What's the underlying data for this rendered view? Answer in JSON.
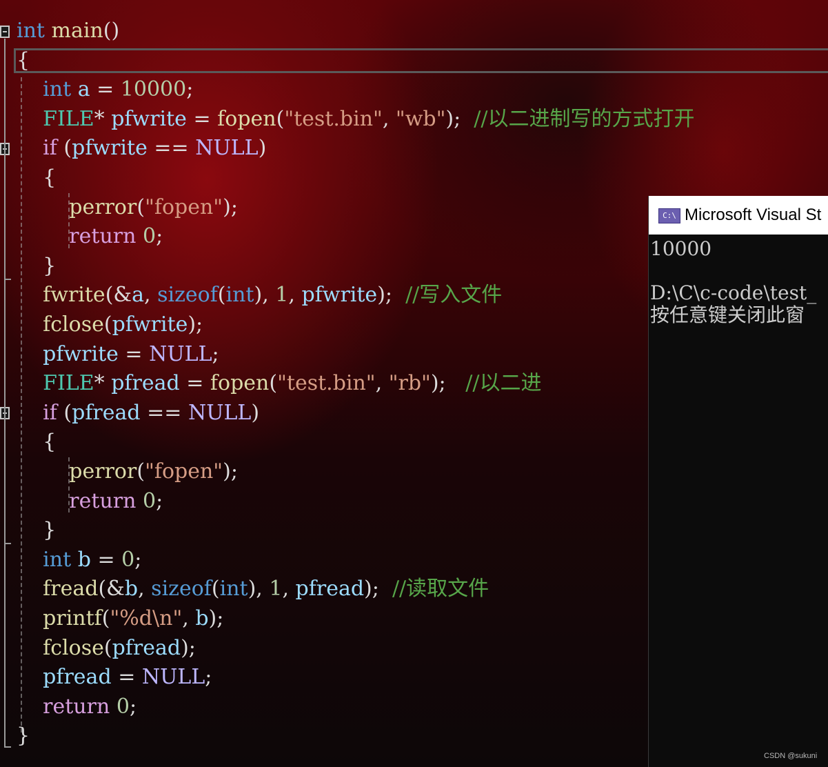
{
  "editor": {
    "lines": [
      [
        {
          "t": "int",
          "c": "kw"
        },
        {
          "t": " ",
          "c": "pl"
        },
        {
          "t": "main",
          "c": "fn"
        },
        {
          "t": "()",
          "c": "pl"
        }
      ],
      [
        {
          "t": "{",
          "c": "pl"
        }
      ],
      [
        {
          "t": "    ",
          "c": "pl"
        },
        {
          "t": "int",
          "c": "kw"
        },
        {
          "t": " ",
          "c": "pl"
        },
        {
          "t": "a",
          "c": "var"
        },
        {
          "t": " = ",
          "c": "pl"
        },
        {
          "t": "10000",
          "c": "num"
        },
        {
          "t": ";",
          "c": "pl"
        }
      ],
      [
        {
          "t": "    ",
          "c": "pl"
        },
        {
          "t": "FILE",
          "c": "ty"
        },
        {
          "t": "* ",
          "c": "pl"
        },
        {
          "t": "pfwrite",
          "c": "var"
        },
        {
          "t": " = ",
          "c": "pl"
        },
        {
          "t": "fopen",
          "c": "fn"
        },
        {
          "t": "(",
          "c": "pl"
        },
        {
          "t": "\"test.bin\"",
          "c": "str"
        },
        {
          "t": ", ",
          "c": "pl"
        },
        {
          "t": "\"wb\"",
          "c": "str"
        },
        {
          "t": ");  ",
          "c": "pl"
        },
        {
          "t": "//以二进制写的方式打开",
          "c": "cmt"
        }
      ],
      [
        {
          "t": "    ",
          "c": "pl"
        },
        {
          "t": "if",
          "c": "ctl"
        },
        {
          "t": " (",
          "c": "pl"
        },
        {
          "t": "pfwrite",
          "c": "var"
        },
        {
          "t": " == ",
          "c": "pl"
        },
        {
          "t": "NULL",
          "c": "mac"
        },
        {
          "t": ")",
          "c": "pl"
        }
      ],
      [
        {
          "t": "    {",
          "c": "pl"
        }
      ],
      [
        {
          "t": "        ",
          "c": "pl"
        },
        {
          "t": "perror",
          "c": "fn"
        },
        {
          "t": "(",
          "c": "pl"
        },
        {
          "t": "\"fopen\"",
          "c": "str"
        },
        {
          "t": ");",
          "c": "pl"
        }
      ],
      [
        {
          "t": "        ",
          "c": "pl"
        },
        {
          "t": "return",
          "c": "ctl"
        },
        {
          "t": " ",
          "c": "pl"
        },
        {
          "t": "0",
          "c": "num"
        },
        {
          "t": ";",
          "c": "pl"
        }
      ],
      [
        {
          "t": "    }",
          "c": "pl"
        }
      ],
      [
        {
          "t": "    ",
          "c": "pl"
        },
        {
          "t": "fwrite",
          "c": "fn"
        },
        {
          "t": "(&",
          "c": "pl"
        },
        {
          "t": "a",
          "c": "var"
        },
        {
          "t": ", ",
          "c": "pl"
        },
        {
          "t": "sizeof",
          "c": "kw"
        },
        {
          "t": "(",
          "c": "pl"
        },
        {
          "t": "int",
          "c": "kw"
        },
        {
          "t": "), ",
          "c": "pl"
        },
        {
          "t": "1",
          "c": "num"
        },
        {
          "t": ", ",
          "c": "pl"
        },
        {
          "t": "pfwrite",
          "c": "var"
        },
        {
          "t": ");  ",
          "c": "pl"
        },
        {
          "t": "//写入文件",
          "c": "cmt"
        }
      ],
      [
        {
          "t": "    ",
          "c": "pl"
        },
        {
          "t": "fclose",
          "c": "fn"
        },
        {
          "t": "(",
          "c": "pl"
        },
        {
          "t": "pfwrite",
          "c": "var"
        },
        {
          "t": ");",
          "c": "pl"
        }
      ],
      [
        {
          "t": "    ",
          "c": "pl"
        },
        {
          "t": "pfwrite",
          "c": "var"
        },
        {
          "t": " = ",
          "c": "pl"
        },
        {
          "t": "NULL",
          "c": "mac"
        },
        {
          "t": ";",
          "c": "pl"
        }
      ],
      [
        {
          "t": "    ",
          "c": "pl"
        },
        {
          "t": "FILE",
          "c": "ty"
        },
        {
          "t": "* ",
          "c": "pl"
        },
        {
          "t": "pfread",
          "c": "var"
        },
        {
          "t": " = ",
          "c": "pl"
        },
        {
          "t": "fopen",
          "c": "fn"
        },
        {
          "t": "(",
          "c": "pl"
        },
        {
          "t": "\"test.bin\"",
          "c": "str"
        },
        {
          "t": ", ",
          "c": "pl"
        },
        {
          "t": "\"rb\"",
          "c": "str"
        },
        {
          "t": ");   ",
          "c": "pl"
        },
        {
          "t": "//以二进",
          "c": "cmt"
        }
      ],
      [
        {
          "t": "    ",
          "c": "pl"
        },
        {
          "t": "if",
          "c": "ctl"
        },
        {
          "t": " (",
          "c": "pl"
        },
        {
          "t": "pfread",
          "c": "var"
        },
        {
          "t": " == ",
          "c": "pl"
        },
        {
          "t": "NULL",
          "c": "mac"
        },
        {
          "t": ")",
          "c": "pl"
        }
      ],
      [
        {
          "t": "    {",
          "c": "pl"
        }
      ],
      [
        {
          "t": "        ",
          "c": "pl"
        },
        {
          "t": "perror",
          "c": "fn"
        },
        {
          "t": "(",
          "c": "pl"
        },
        {
          "t": "\"fopen\"",
          "c": "str"
        },
        {
          "t": ");",
          "c": "pl"
        }
      ],
      [
        {
          "t": "        ",
          "c": "pl"
        },
        {
          "t": "return",
          "c": "ctl"
        },
        {
          "t": " ",
          "c": "pl"
        },
        {
          "t": "0",
          "c": "num"
        },
        {
          "t": ";",
          "c": "pl"
        }
      ],
      [
        {
          "t": "    }",
          "c": "pl"
        }
      ],
      [
        {
          "t": "    ",
          "c": "pl"
        },
        {
          "t": "int",
          "c": "kw"
        },
        {
          "t": " ",
          "c": "pl"
        },
        {
          "t": "b",
          "c": "var"
        },
        {
          "t": " = ",
          "c": "pl"
        },
        {
          "t": "0",
          "c": "num"
        },
        {
          "t": ";",
          "c": "pl"
        }
      ],
      [
        {
          "t": "    ",
          "c": "pl"
        },
        {
          "t": "fread",
          "c": "fn"
        },
        {
          "t": "(&",
          "c": "pl"
        },
        {
          "t": "b",
          "c": "var"
        },
        {
          "t": ", ",
          "c": "pl"
        },
        {
          "t": "sizeof",
          "c": "kw"
        },
        {
          "t": "(",
          "c": "pl"
        },
        {
          "t": "int",
          "c": "kw"
        },
        {
          "t": "), ",
          "c": "pl"
        },
        {
          "t": "1",
          "c": "num"
        },
        {
          "t": ", ",
          "c": "pl"
        },
        {
          "t": "pfread",
          "c": "var"
        },
        {
          "t": ");  ",
          "c": "pl"
        },
        {
          "t": "//读取文件",
          "c": "cmt"
        }
      ],
      [
        {
          "t": "    ",
          "c": "pl"
        },
        {
          "t": "printf",
          "c": "fn"
        },
        {
          "t": "(",
          "c": "pl"
        },
        {
          "t": "\"%d\\n\"",
          "c": "str"
        },
        {
          "t": ", ",
          "c": "pl"
        },
        {
          "t": "b",
          "c": "var"
        },
        {
          "t": ");",
          "c": "pl"
        }
      ],
      [
        {
          "t": "    ",
          "c": "pl"
        },
        {
          "t": "fclose",
          "c": "fn"
        },
        {
          "t": "(",
          "c": "pl"
        },
        {
          "t": "pfread",
          "c": "var"
        },
        {
          "t": ");",
          "c": "pl"
        }
      ],
      [
        {
          "t": "    ",
          "c": "pl"
        },
        {
          "t": "pfread",
          "c": "var"
        },
        {
          "t": " = ",
          "c": "pl"
        },
        {
          "t": "NULL",
          "c": "mac"
        },
        {
          "t": ";",
          "c": "pl"
        }
      ],
      [
        {
          "t": "    ",
          "c": "pl"
        },
        {
          "t": "return",
          "c": "ctl"
        },
        {
          "t": " ",
          "c": "pl"
        },
        {
          "t": "0",
          "c": "num"
        },
        {
          "t": ";",
          "c": "pl"
        }
      ],
      [
        {
          "t": "}",
          "c": "pl"
        }
      ]
    ]
  },
  "console": {
    "icon_label": "C:\\",
    "title": "Microsoft Visual St",
    "output_lines": [
      "10000",
      "",
      "D:\\C\\c-code\\test_",
      "按任意键关闭此窗"
    ]
  },
  "watermark": "CSDN @sukuni",
  "colors": {
    "keyword": "#569cd6",
    "type": "#4ec9b0",
    "function": "#dcdcaa",
    "variable": "#9cdcfe",
    "string": "#d69d85",
    "number": "#b5cea8",
    "comment": "#57a64a",
    "macro": "#beb7ff",
    "control": "#d8a0df"
  }
}
